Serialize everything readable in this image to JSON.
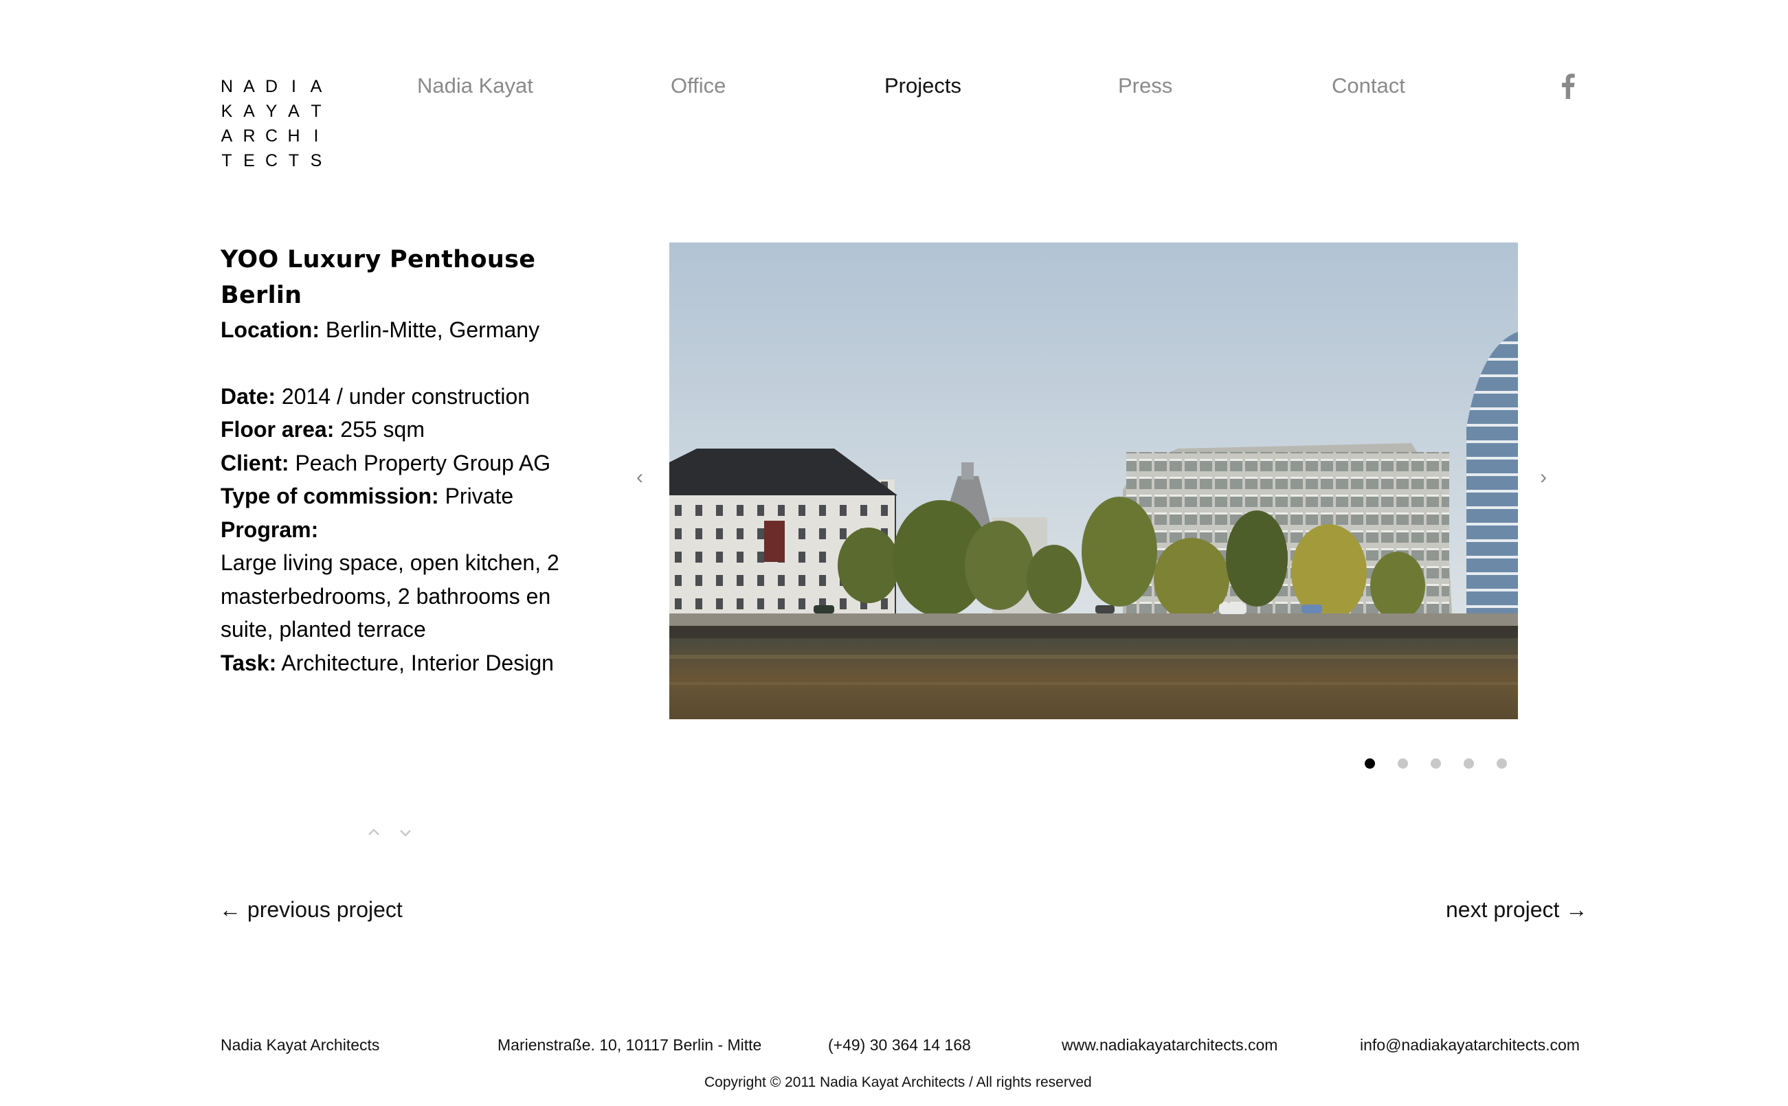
{
  "logo": {
    "rows": [
      [
        "N",
        "A",
        "D",
        "I",
        "A"
      ],
      [
        "K",
        "A",
        "Y",
        "A",
        "T"
      ],
      [
        "A",
        "R",
        "C",
        "H",
        "I"
      ],
      [
        "T",
        "E",
        "C",
        "T",
        "S"
      ]
    ]
  },
  "nav": {
    "items": [
      {
        "label": "Nadia Kayat",
        "active": false
      },
      {
        "label": "Office",
        "active": false
      },
      {
        "label": "Projects",
        "active": true
      },
      {
        "label": "Press",
        "active": false
      },
      {
        "label": "Contact",
        "active": false
      }
    ],
    "social_icon": "facebook-icon"
  },
  "project": {
    "title_line1": "YOO Luxury Penthouse",
    "title_line2": "Berlin",
    "location_label": "Location:",
    "location_value": "Berlin-Mitte, Germany",
    "date_label": "Date:",
    "date_value": "2014 / under construction",
    "floor_label": "Floor area:",
    "floor_value": "255 sqm",
    "client_label": "Client:",
    "client_value": "Peach Property Group AG",
    "commission_label": "Type of commission:",
    "commission_value": "Private",
    "program_label": "Program:",
    "program_line1": "Large living space, open kitchen, 2",
    "program_line2": "masterbedrooms, 2 bathrooms en",
    "program_line3": "suite, planted terrace",
    "task_label": "Task:",
    "task_value": "Architecture, Interior Design"
  },
  "gallery": {
    "prev_arrow": "‹",
    "next_arrow": "›",
    "slide_count": 5,
    "active_slide": 1,
    "colors": {
      "sky_top": "#b6c6d6",
      "sky_bottom": "#e4e9ea",
      "water": "#5e4d32",
      "trees": "#59692f"
    }
  },
  "scroll_controls": {
    "up_icon": "chevron-up-icon",
    "down_icon": "chevron-down-icon"
  },
  "pager": {
    "previous": "← previous project",
    "next": "next project →"
  },
  "footer": {
    "name": "Nadia Kayat Architects",
    "address": "Marienstraße. 10, 10117 Berlin - Mitte",
    "phone": "(+49) 30 364 14 168",
    "website": "www.nadiakayatarchitects.com",
    "email": "info@nadiakayatarchitects.com",
    "copyright": "Copyright © 2011 Nadia Kayat Architects / All rights reserved"
  }
}
